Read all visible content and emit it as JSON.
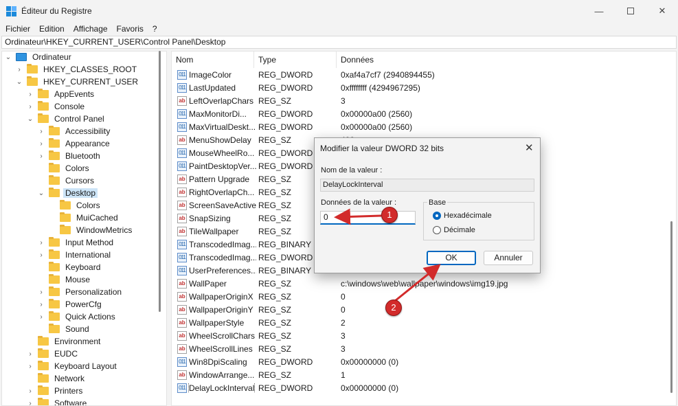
{
  "window": {
    "title": "Éditeur du Registre",
    "controls": {
      "minimize": "—",
      "close": "✕"
    }
  },
  "menu": [
    "Fichier",
    "Edition",
    "Affichage",
    "Favoris",
    "?"
  ],
  "address": "Ordinateur\\HKEY_CURRENT_USER\\Control Panel\\Desktop",
  "tree": [
    {
      "label": "Ordinateur",
      "chevron": "⌄",
      "icon": "computer"
    },
    {
      "label": "HKEY_CLASSES_ROOT",
      "chevron": "›",
      "icon": "folder"
    },
    {
      "label": "HKEY_CURRENT_USER",
      "chevron": "⌄",
      "icon": "folder"
    },
    {
      "label": "AppEvents",
      "chevron": "›",
      "icon": "folder"
    },
    {
      "label": "Console",
      "chevron": "›",
      "icon": "folder"
    },
    {
      "label": "Control Panel",
      "chevron": "⌄",
      "icon": "folder"
    },
    {
      "label": "Accessibility",
      "chevron": "›",
      "icon": "folder"
    },
    {
      "label": "Appearance",
      "chevron": "›",
      "icon": "folder"
    },
    {
      "label": "Bluetooth",
      "chevron": "›",
      "icon": "folder"
    },
    {
      "label": "Colors",
      "chevron": "",
      "icon": "folder"
    },
    {
      "label": "Cursors",
      "chevron": "",
      "icon": "folder"
    },
    {
      "label": "Desktop",
      "chevron": "⌄",
      "icon": "folder",
      "selected": true
    },
    {
      "label": "Colors",
      "chevron": "",
      "icon": "folder"
    },
    {
      "label": "MuiCached",
      "chevron": "",
      "icon": "folder"
    },
    {
      "label": "WindowMetrics",
      "chevron": "",
      "icon": "folder"
    },
    {
      "label": "Input Method",
      "chevron": "›",
      "icon": "folder"
    },
    {
      "label": "International",
      "chevron": "›",
      "icon": "folder"
    },
    {
      "label": "Keyboard",
      "chevron": "",
      "icon": "folder"
    },
    {
      "label": "Mouse",
      "chevron": "",
      "icon": "folder"
    },
    {
      "label": "Personalization",
      "chevron": "›",
      "icon": "folder"
    },
    {
      "label": "PowerCfg",
      "chevron": "›",
      "icon": "folder"
    },
    {
      "label": "Quick Actions",
      "chevron": "›",
      "icon": "folder"
    },
    {
      "label": "Sound",
      "chevron": "",
      "icon": "folder"
    },
    {
      "label": "Environment",
      "chevron": "",
      "icon": "folder"
    },
    {
      "label": "EUDC",
      "chevron": "›",
      "icon": "folder"
    },
    {
      "label": "Keyboard Layout",
      "chevron": "›",
      "icon": "folder"
    },
    {
      "label": "Network",
      "chevron": "",
      "icon": "folder"
    },
    {
      "label": "Printers",
      "chevron": "›",
      "icon": "folder"
    },
    {
      "label": "Software",
      "chevron": "›",
      "icon": "folder"
    }
  ],
  "columns": {
    "name": "Nom",
    "type": "Type",
    "data": "Données"
  },
  "values": [
    {
      "name": "ImageColor",
      "type": "REG_DWORD",
      "data": "0xaf4a7cf7 (2940894455)",
      "kind": "dword"
    },
    {
      "name": "LastUpdated",
      "type": "REG_DWORD",
      "data": "0xffffffff (4294967295)",
      "kind": "dword"
    },
    {
      "name": "LeftOverlapChars",
      "type": "REG_SZ",
      "data": "3",
      "kind": "sz"
    },
    {
      "name": "MaxMonitorDi...",
      "type": "REG_DWORD",
      "data": "0x00000a00 (2560)",
      "kind": "dword"
    },
    {
      "name": "MaxVirtualDeskt...",
      "type": "REG_DWORD",
      "data": "0x00000a00 (2560)",
      "kind": "dword"
    },
    {
      "name": "MenuShowDelay",
      "type": "REG_SZ",
      "data": "400",
      "kind": "sz"
    },
    {
      "name": "MouseWheelRo...",
      "type": "REG_DWORD",
      "data": "",
      "kind": "dword"
    },
    {
      "name": "PaintDesktopVer...",
      "type": "REG_DWORD",
      "data": "",
      "kind": "dword"
    },
    {
      "name": "Pattern Upgrade",
      "type": "REG_SZ",
      "data": "",
      "kind": "sz"
    },
    {
      "name": "RightOverlapCh...",
      "type": "REG_SZ",
      "data": "",
      "kind": "sz"
    },
    {
      "name": "ScreenSaveActive",
      "type": "REG_SZ",
      "data": "",
      "kind": "sz"
    },
    {
      "name": "SnapSizing",
      "type": "REG_SZ",
      "data": "",
      "kind": "sz"
    },
    {
      "name": "TileWallpaper",
      "type": "REG_SZ",
      "data": "",
      "kind": "sz"
    },
    {
      "name": "TranscodedImag...",
      "type": "REG_BINARY",
      "data": "",
      "kind": "binary"
    },
    {
      "name": "TranscodedImag...",
      "type": "REG_DWORD",
      "data": "",
      "kind": "dword"
    },
    {
      "name": "UserPreferences...",
      "type": "REG_BINARY",
      "data": "",
      "kind": "binary"
    },
    {
      "name": "WallPaper",
      "type": "REG_SZ",
      "data": "c:\\windows\\web\\wallpaper\\windows\\img19.jpg",
      "kind": "sz"
    },
    {
      "name": "WallpaperOriginX",
      "type": "REG_SZ",
      "data": "0",
      "kind": "sz"
    },
    {
      "name": "WallpaperOriginY",
      "type": "REG_SZ",
      "data": "0",
      "kind": "sz"
    },
    {
      "name": "WallpaperStyle",
      "type": "REG_SZ",
      "data": "2",
      "kind": "sz"
    },
    {
      "name": "WheelScrollChars",
      "type": "REG_SZ",
      "data": "3",
      "kind": "sz"
    },
    {
      "name": "WheelScrollLines",
      "type": "REG_SZ",
      "data": "3",
      "kind": "sz"
    },
    {
      "name": "Win8DpiScaling",
      "type": "REG_DWORD",
      "data": "0x00000000 (0)",
      "kind": "dword"
    },
    {
      "name": "WindowArrange...",
      "type": "REG_SZ",
      "data": "1",
      "kind": "sz"
    },
    {
      "name": "DelayLockInterval",
      "type": "REG_DWORD",
      "data": "0x00000000 (0)",
      "kind": "dword",
      "highlight": true
    }
  ],
  "icon_glyphs": {
    "dword": "011",
    "sz": "ab",
    "binary": "011"
  },
  "dialog": {
    "title": "Modifier la valeur DWORD 32 bits",
    "close": "✕",
    "value_name_label": "Nom de la valeur :",
    "value_name": "DelayLockInterval",
    "value_data_label": "Données de la valeur :",
    "value_data": "0",
    "base_label": "Base",
    "hex_label": "Hexadécimale",
    "dec_label": "Décimale",
    "ok_label": "OK",
    "cancel_label": "Annuler",
    "selected_base": "hex"
  },
  "annotations": {
    "step1": "1",
    "step2": "2",
    "color": "#d22b2b"
  }
}
